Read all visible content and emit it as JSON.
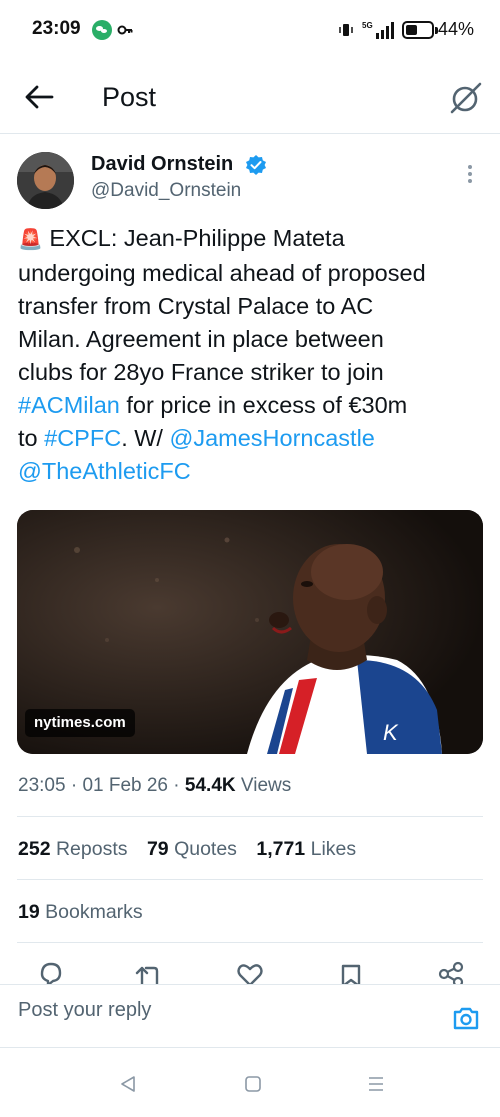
{
  "status_bar": {
    "time": "23:09",
    "battery_pct_label": "44%",
    "battery_level": 0.44,
    "network": "5G",
    "icons": [
      "wechat-icon",
      "key-icon",
      "vibrate-icon",
      "signal-icon",
      "battery-icon"
    ]
  },
  "header": {
    "title": "Post",
    "back_icon": "arrow-left-icon",
    "grok_icon": "grok-icon"
  },
  "tweet": {
    "author_name": "David Ornstein",
    "author_handle": "@David_Ornstein",
    "verified": true,
    "text_lines": [
      {
        "emoji": "🚨",
        "text": " EXCL: Jean-Philippe Mateta"
      },
      {
        "text": "undergoing medical ahead of proposed"
      },
      {
        "text": "transfer from Crystal Palace to AC"
      },
      {
        "text": "Milan. Agreement in place between"
      },
      {
        "text": "clubs for 28yo France striker to join"
      },
      {
        "link": "#ACMilan",
        "after": " for price in excess of €30m"
      },
      {
        "before": "to ",
        "link": "#CPFC",
        "after": ". W/ ",
        "link2": "@JamesHorncastle"
      },
      {
        "link": "@TheAthleticFC"
      }
    ],
    "media_source": "nytimes.com",
    "time": "23:05",
    "date": "01 Feb 26",
    "views_count": "54.4K",
    "views_label": "Views",
    "separator": "·",
    "reposts_count": "252",
    "reposts_label": "Reposts",
    "quotes_count": "79",
    "quotes_label": "Quotes",
    "likes_count": "1,771",
    "likes_label": "Likes",
    "bookmarks_count": "19",
    "bookmarks_label": "Bookmarks"
  },
  "actions": [
    "reply-icon",
    "repost-icon",
    "like-icon",
    "bookmark-icon",
    "share-icon"
  ],
  "reply": {
    "placeholder": "Post your reply",
    "camera_icon": "camera-icon"
  },
  "nav": [
    "back-triangle-icon",
    "home-square-icon",
    "menu-lines-icon"
  ],
  "colors": {
    "link": "#1d9bf0",
    "secondary_text": "#536471",
    "primary_text": "#0f1419",
    "divider": "#e1e8ed",
    "verified": "#1d9bf0"
  }
}
